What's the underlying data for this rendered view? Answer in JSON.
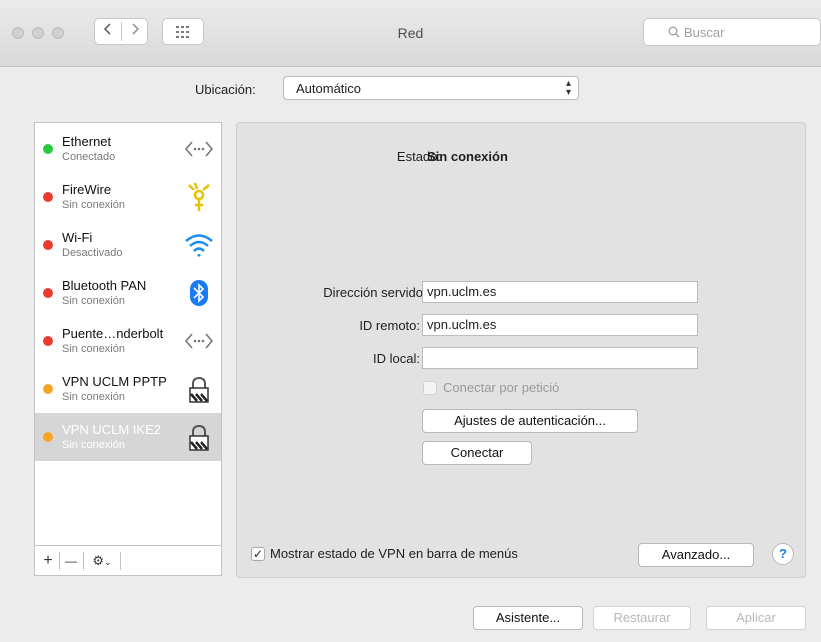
{
  "window": {
    "title": "Red"
  },
  "toolbar": {
    "search_placeholder": "Buscar"
  },
  "location": {
    "label": "Ubicación:",
    "value": "Automático"
  },
  "services": [
    {
      "name": "Ethernet",
      "status": "Conectado",
      "dot_color": "#27c93f",
      "icon": "ethernet-icon"
    },
    {
      "name": "FireWire",
      "status": "Sin conexión",
      "dot_color": "#ea3b30",
      "icon": "firewire-icon"
    },
    {
      "name": "Wi-Fi",
      "status": "Desactivado",
      "dot_color": "#ea3b30",
      "icon": "wifi-icon"
    },
    {
      "name": "Bluetooth PAN",
      "status": "Sin conexión",
      "dot_color": "#ea3b30",
      "icon": "bluetooth-icon"
    },
    {
      "name": "Puente…nderbolt",
      "status": "Sin conexión",
      "dot_color": "#ea3b30",
      "icon": "thunderbolt-bridge-icon"
    },
    {
      "name": "VPN UCLM PPTP",
      "status": "Sin conexión",
      "dot_color": "#f5a623",
      "icon": "vpn-lock-icon"
    },
    {
      "name": "VPN UCLM IKE2",
      "status": "Sin conexión",
      "dot_color": "#f5a623",
      "icon": "vpn-lock-icon"
    }
  ],
  "sidebar_tools": {
    "add": "+",
    "remove": "—",
    "gear": "⚙"
  },
  "detail": {
    "status_label": "Estado:",
    "status_value": "Sin conexión",
    "server_label": "Dirección servido",
    "server_value": "vpn.uclm.es",
    "remote_id_label": "ID remoto:",
    "remote_id_value": "vpn.uclm.es",
    "local_id_label": "ID local:",
    "local_id_value": "",
    "on_demand_label": "Conectar por petició",
    "auth_button": "Ajustes de autenticación...",
    "connect_button": "Conectar",
    "show_vpn_label": "Mostrar estado de VPN en barra de menús",
    "show_vpn_checked": "✓",
    "advanced_button": "Avanzado...",
    "help": "?"
  },
  "footer": {
    "assistant": "Asistente...",
    "revert": "Restaurar",
    "apply": "Aplicar"
  },
  "colors": {
    "accent": "#1a7cf5",
    "selected_row": "#d6d6d6"
  }
}
